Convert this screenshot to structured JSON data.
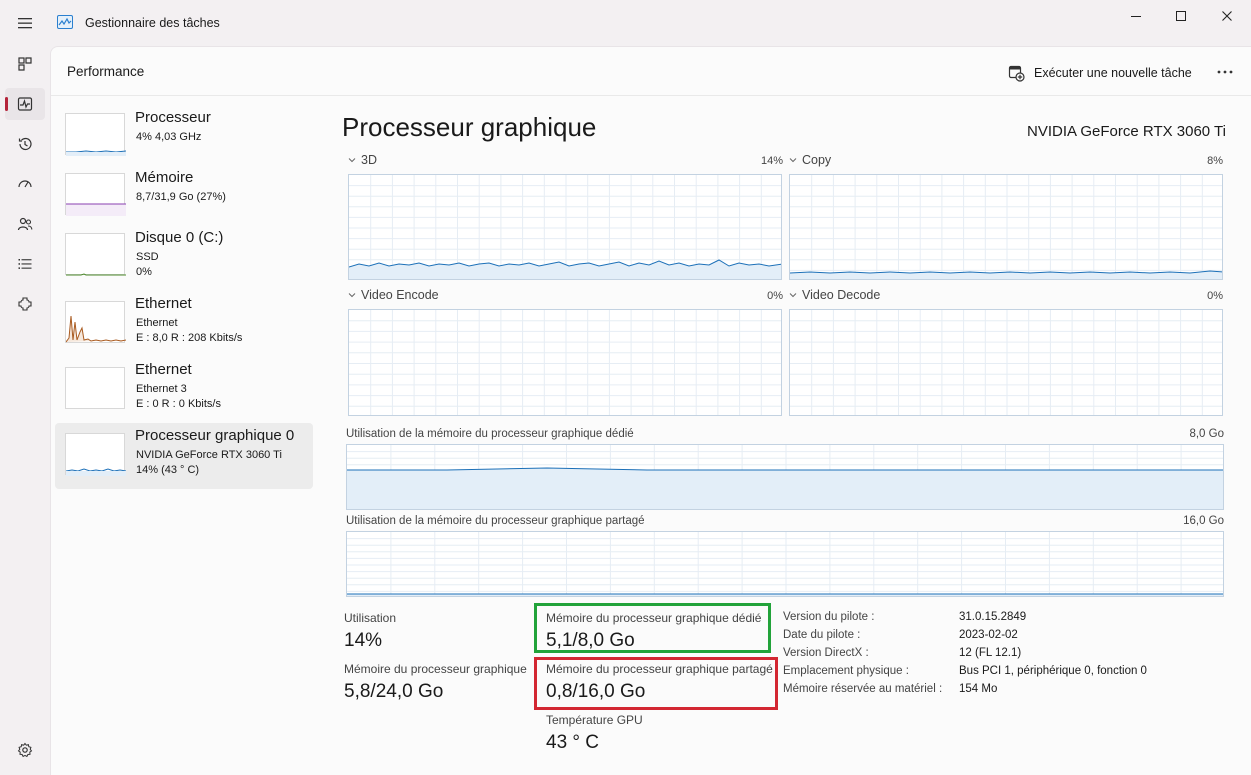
{
  "app": {
    "title": "Gestionnaire des tâches"
  },
  "header": {
    "section_title": "Performance",
    "run_task_label": "Exécuter une nouvelle tâche"
  },
  "devices": [
    {
      "name": "Processeur",
      "line1": "4% 4,03 GHz",
      "line2": "",
      "line3": ""
    },
    {
      "name": "Mémoire",
      "line1": "8,7/31,9 Go (27%)",
      "line2": "",
      "line3": ""
    },
    {
      "name": "Disque 0 (C:)",
      "line1": "SSD",
      "line2": "0%",
      "line3": ""
    },
    {
      "name": "Ethernet",
      "line1": "Ethernet",
      "line2": "E : 8,0 R : 208 Kbits/s",
      "line3": ""
    },
    {
      "name": "Ethernet",
      "line1": "Ethernet 3",
      "line2": "E : 0 R : 0 Kbits/s",
      "line3": ""
    },
    {
      "name": "Processeur graphique 0",
      "line1": "NVIDIA GeForce RTX 3060 Ti",
      "line2": "14% (43 ° C)",
      "line3": ""
    }
  ],
  "gpu": {
    "title": "Processeur graphique",
    "model": "NVIDIA GeForce RTX 3060 Ti",
    "engines": [
      {
        "name": "3D",
        "percent": "14%"
      },
      {
        "name": "Copy",
        "percent": "8%"
      },
      {
        "name": "Video Encode",
        "percent": "0%"
      },
      {
        "name": "Video Decode",
        "percent": "0%"
      }
    ],
    "dedicated_graph_label": "Utilisation de la mémoire du processeur graphique dédié",
    "dedicated_graph_max": "8,0 Go",
    "shared_graph_label": "Utilisation de la mémoire du processeur graphique partagé",
    "shared_graph_max": "16,0 Go"
  },
  "stats": {
    "utilisation_label": "Utilisation",
    "utilisation_value": "14%",
    "gpu_mem_label": "Mémoire du processeur graphique",
    "gpu_mem_value": "5,8/24,0 Go",
    "dedicated_label": "Mémoire du processeur graphique dédié",
    "dedicated_value": "5,1/8,0 Go",
    "shared_label": "Mémoire du processeur graphique partagé",
    "shared_value": "0,8/16,0 Go",
    "temp_label": "Température GPU",
    "temp_value": "43 ° C"
  },
  "info": [
    {
      "key": "Version du pilote :",
      "value": "31.0.15.2849"
    },
    {
      "key": "Date du pilote :",
      "value": "2023-02-02"
    },
    {
      "key": "Version DirectX :",
      "value": "12 (FL 12.1)"
    },
    {
      "key": "Emplacement physique :",
      "value": "Bus PCI 1, périphérique 0, fonction 0"
    },
    {
      "key": "Mémoire réservée au matériel :",
      "value": "154 Mo"
    }
  ],
  "colors": {
    "accent": "#b4233a",
    "gpu_line": "#1c70b8",
    "memory_line": "#8a3fb0",
    "ethernet_line": "#a95a1f",
    "highlight_green": "#22a33a",
    "highlight_red": "#d32732"
  }
}
